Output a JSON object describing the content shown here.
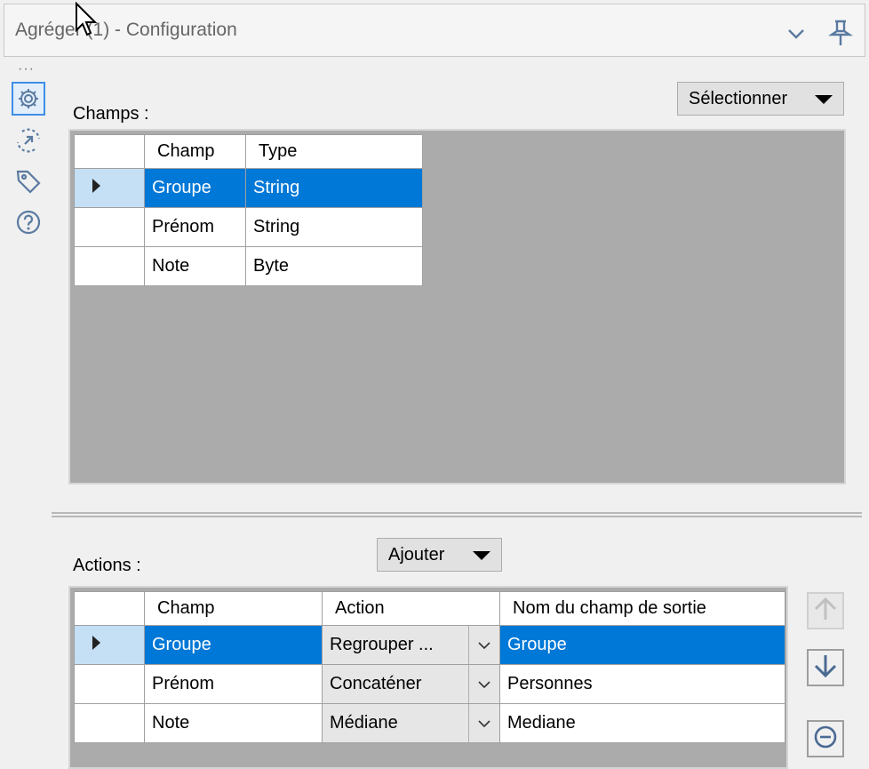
{
  "window": {
    "title": "Agréger (1) - Configuration",
    "icons": [
      "chevron-down-icon",
      "pin-icon"
    ]
  },
  "sidebar": {
    "icons": [
      "gear-icon",
      "connection-arrow-icon",
      "tag-icon",
      "help-icon"
    ],
    "active": "gear-icon"
  },
  "fields": {
    "label": "Champs :",
    "select_button": "Sélectionner",
    "columns": [
      "Champ",
      "Type"
    ],
    "rows": [
      {
        "champ": "Groupe",
        "type": "String",
        "selected": true
      },
      {
        "champ": "Prénom",
        "type": "String",
        "selected": false
      },
      {
        "champ": "Note",
        "type": "Byte",
        "selected": false
      }
    ]
  },
  "actions": {
    "label": "Actions :",
    "add_button": "Ajouter",
    "columns": [
      "Champ",
      "Action",
      "Nom du champ de sortie"
    ],
    "rows": [
      {
        "champ": "Groupe",
        "action": "Regrouper ...",
        "output": "Groupe",
        "selected": true
      },
      {
        "champ": "Prénom",
        "action": "Concaténer",
        "output": "Personnes",
        "selected": false
      },
      {
        "champ": "Note",
        "action": "Médiane",
        "output": "Mediane",
        "selected": false
      }
    ],
    "side_buttons": [
      "move-up-icon",
      "move-down-icon",
      "remove-icon"
    ]
  },
  "colors": {
    "selection": "#0078d7",
    "row_header_selected": "#c5dff5",
    "grid_background": "#ababab",
    "active_icon_border": "#3c8ee6"
  }
}
